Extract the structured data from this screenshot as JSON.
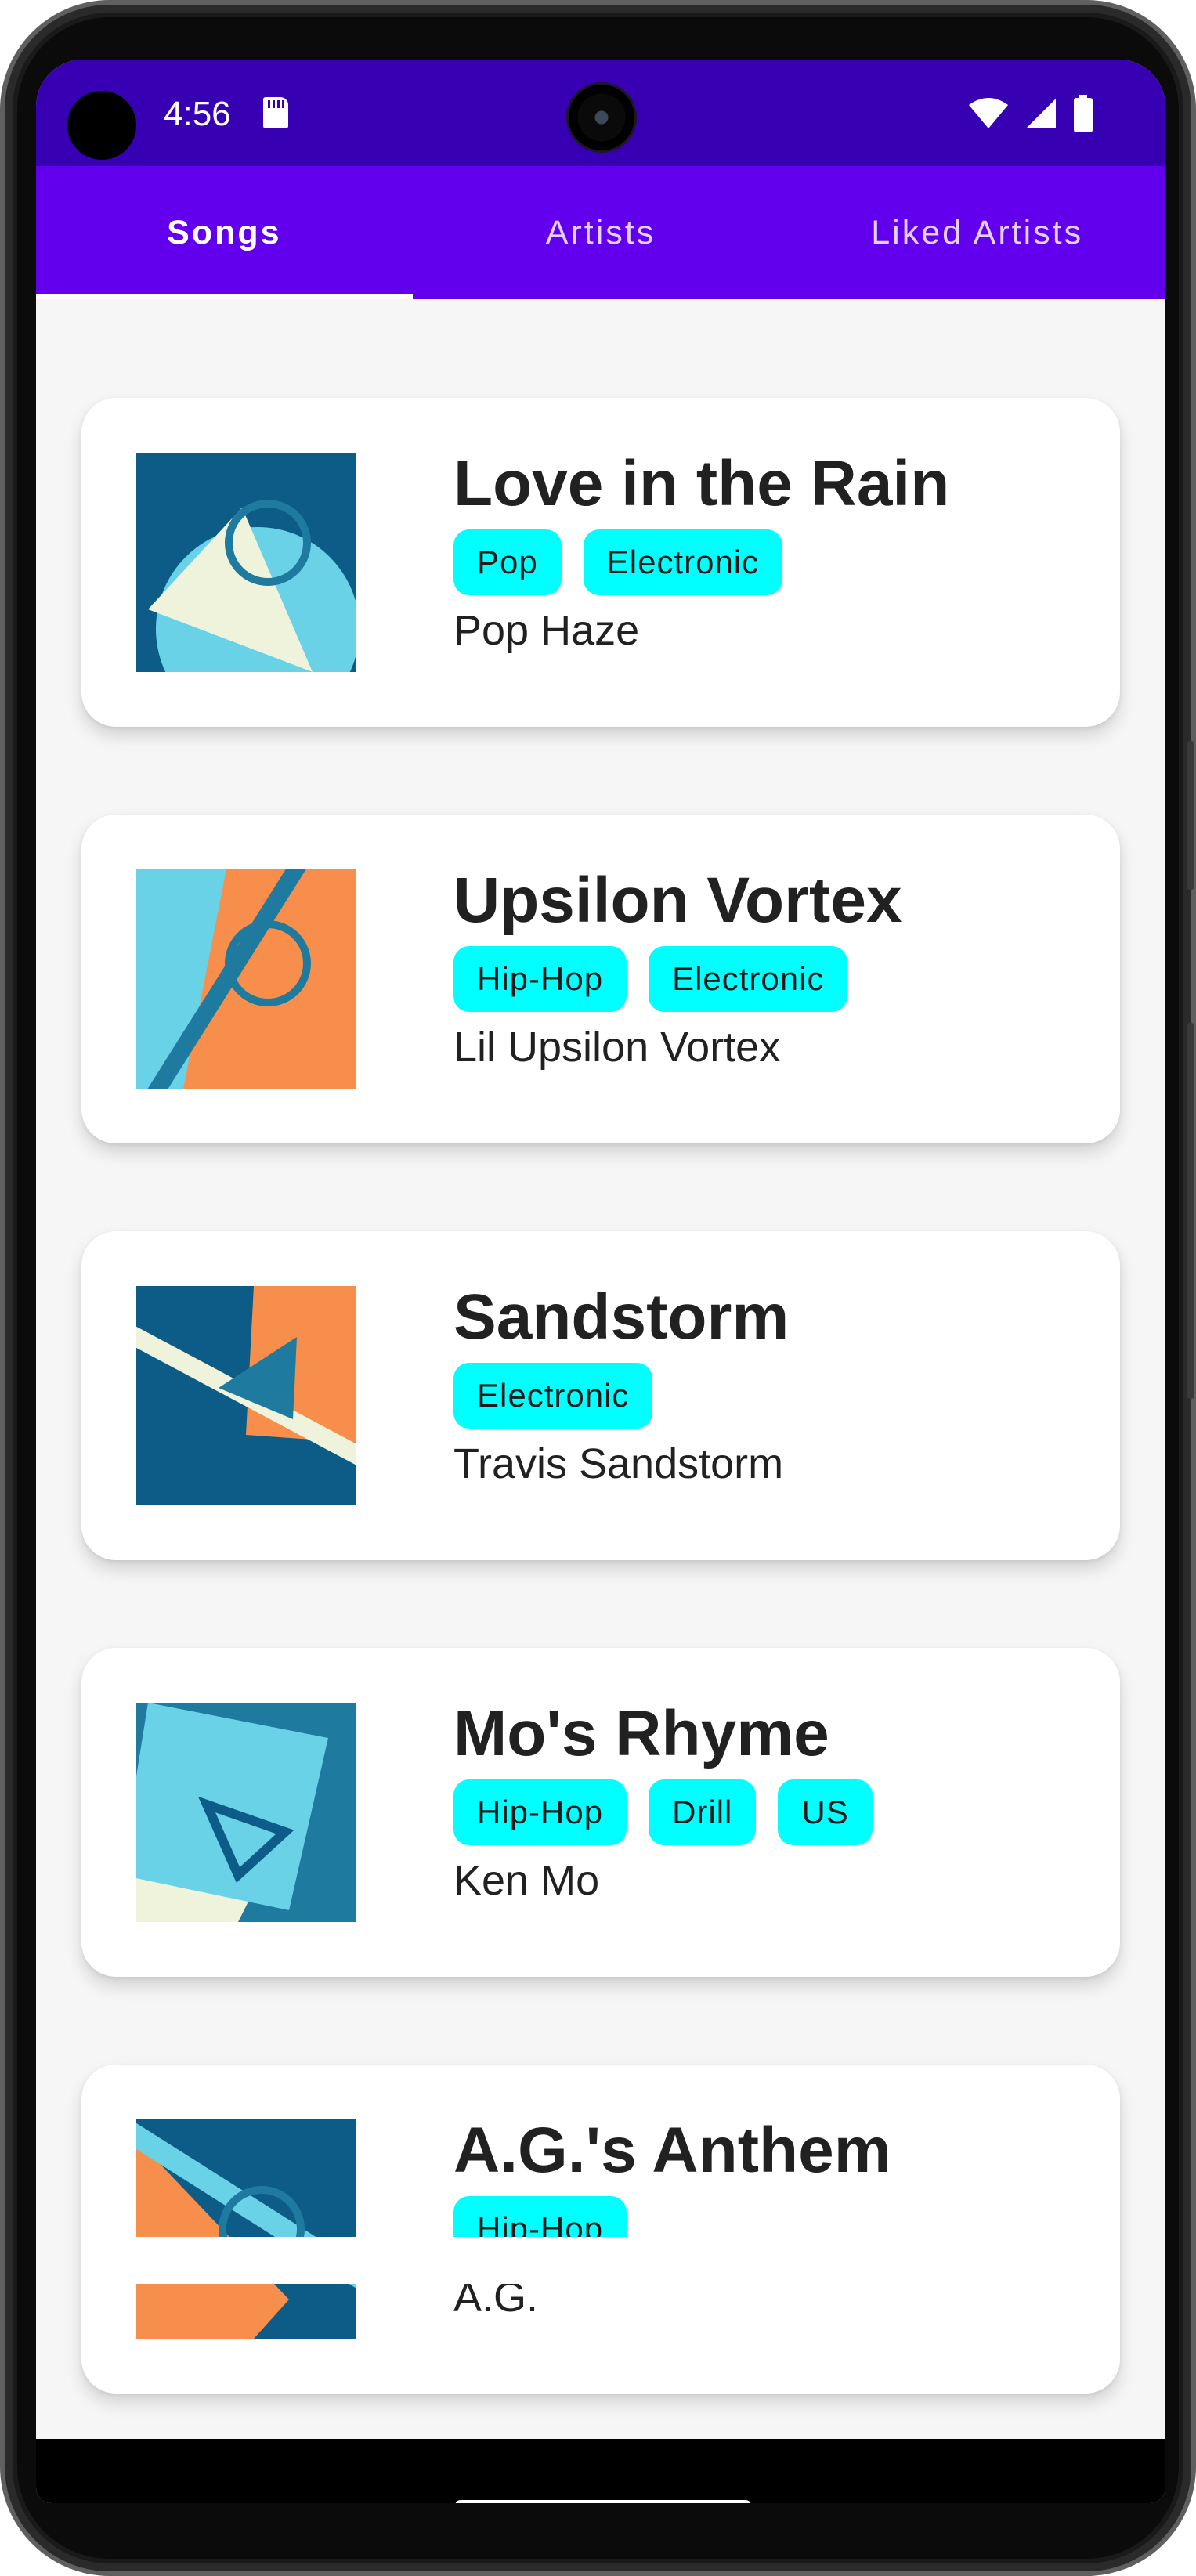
{
  "status_bar": {
    "time": "4:56",
    "icons": [
      "sd-card-icon",
      "wifi-icon",
      "signal-icon",
      "battery-icon"
    ],
    "background": "#3700b3"
  },
  "tabs": [
    {
      "label": "Songs",
      "active": true
    },
    {
      "label": "Artists",
      "active": false
    },
    {
      "label": "Liked Artists",
      "active": false
    }
  ],
  "theme": {
    "tab_bar_color": "#6200ee",
    "chip_color": "#00ffff",
    "card_color": "#ffffff"
  },
  "songs": [
    {
      "title": "Love in the Rain",
      "genres": [
        "Pop",
        "Electronic"
      ],
      "artist": "Pop Haze"
    },
    {
      "title": "Upsilon Vortex",
      "genres": [
        "Hip-Hop",
        "Electronic"
      ],
      "artist": "Lil Upsilon Vortex"
    },
    {
      "title": "Sandstorm",
      "genres": [
        "Electronic"
      ],
      "artist": "Travis Sandstorm"
    },
    {
      "title": "Mo's Rhyme",
      "genres": [
        "Hip-Hop",
        "Drill",
        "US"
      ],
      "artist": "Ken Mo"
    },
    {
      "title": "A.G.'s Anthem",
      "genres": [
        "Hip-Hop"
      ],
      "artist": "A.G."
    }
  ]
}
